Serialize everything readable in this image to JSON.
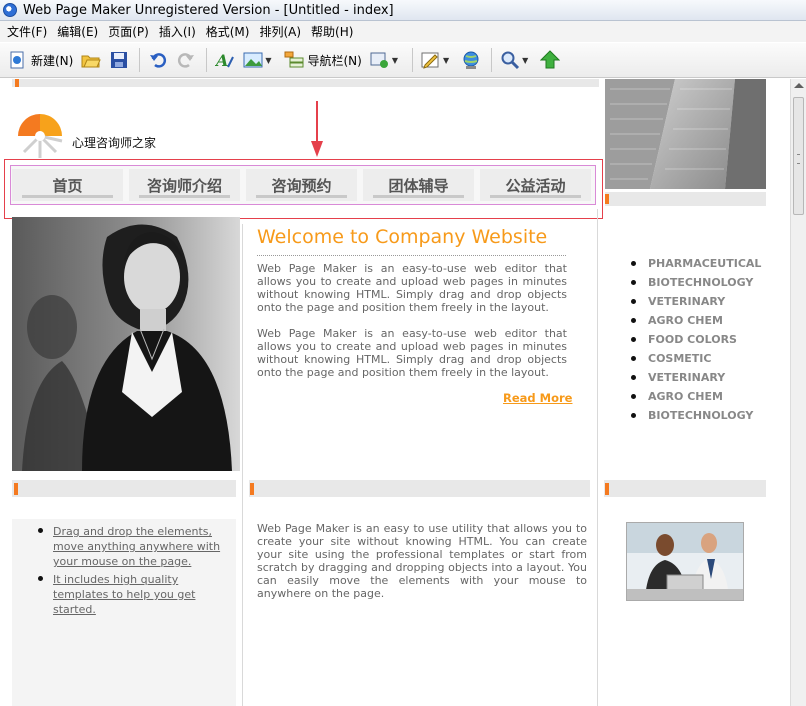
{
  "window": {
    "title": "Web Page Maker Unregistered Version - [Untitled - index]"
  },
  "menu": [
    "文件(F)",
    "编辑(E)",
    "页面(P)",
    "插入(I)",
    "格式(M)",
    "排列(A)",
    "帮助(H)"
  ],
  "toolbar": {
    "new_label": "新建(N)",
    "navbar_label": "导航栏(N)"
  },
  "site": {
    "logo_text": "心理咨询师之家"
  },
  "nav": [
    "首页",
    "咨询师介绍",
    "咨询预约",
    "团体辅导",
    "公益活动"
  ],
  "welcome": {
    "title": "Welcome to Company Website",
    "para1": "Web Page Maker is an easy-to-use web editor that allows you to create and upload web pages in minutes without knowing HTML. Simply drag and drop objects onto the page and position them freely in the layout.",
    "para2": "Web Page Maker is an easy-to-use web editor that allows you to create and upload web pages in minutes without knowing HTML. Simply drag and drop objects onto the page and position them freely in the layout.",
    "read_more": "Read More"
  },
  "right_list": [
    "PHARMACEUTICAL",
    "BIOTECHNOLOGY",
    "VETERINARY",
    "AGRO CHEM",
    "FOOD COLORS",
    "COSMETIC",
    "VETERINARY",
    "AGRO CHEM",
    "BIOTECHNOLOGY"
  ],
  "bottom_left_list": [
    "Drag and drop the elements, move anything anywhere with your mouse on the page.",
    "It includes high quality templates to help you get started."
  ],
  "bottom_mid_text": "Web Page Maker is an easy to use utility that allows you to create your site without knowing HTML. You can create your site using the professional templates or start from scratch by dragging and dropping objects into a layout. You can easily move the elements with your mouse to anywhere on the page.",
  "colors": {
    "accent_orange": "#f79a1a",
    "tab_orange": "#f47a20",
    "highlight_red": "#e5404b"
  }
}
